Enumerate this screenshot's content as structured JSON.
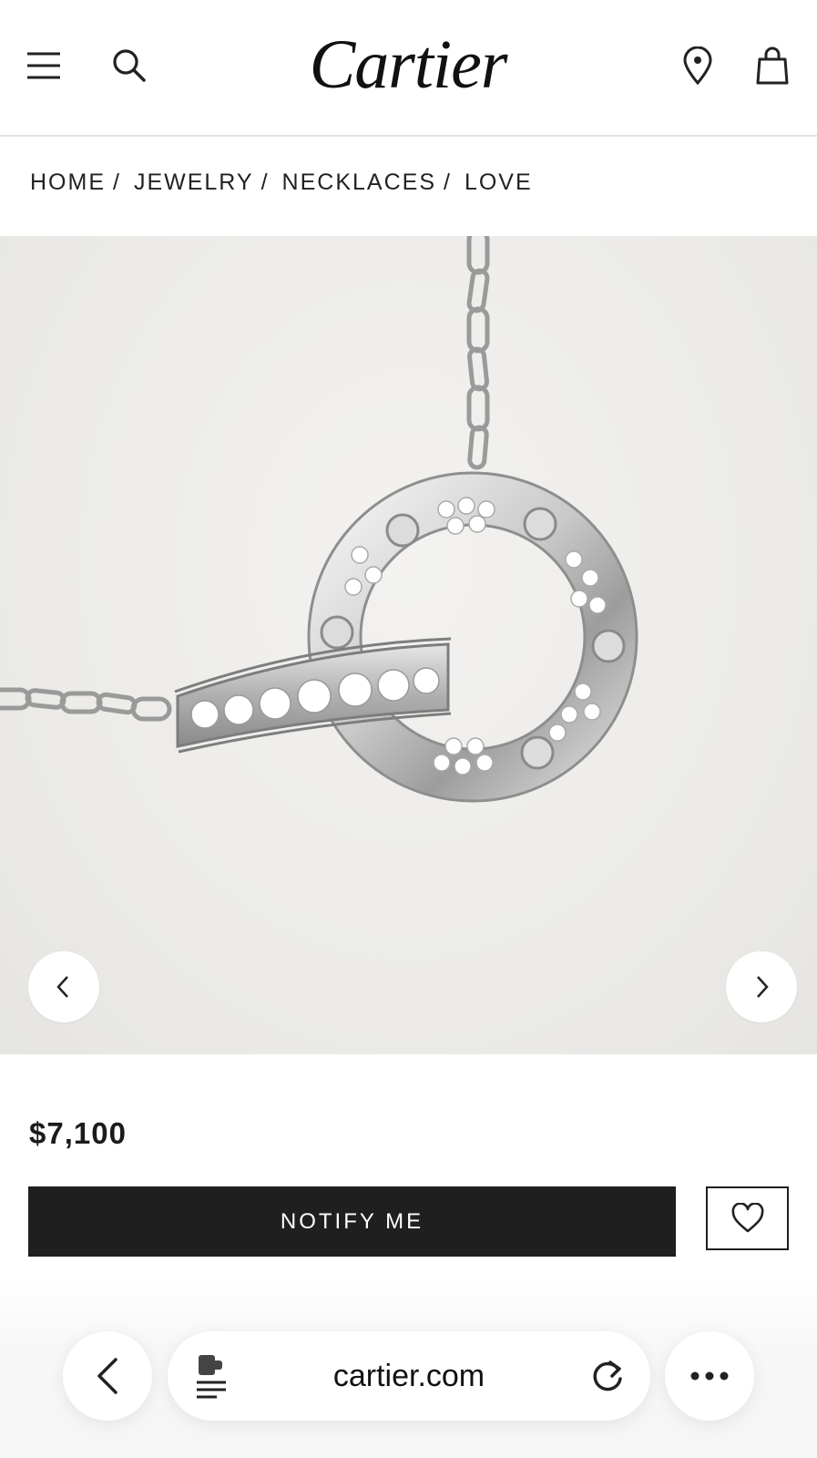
{
  "header": {
    "logo": "Cartier",
    "icons": [
      "menu-icon",
      "search-icon",
      "location-pin-icon",
      "shopping-bag-icon"
    ]
  },
  "breadcrumb": {
    "items": [
      "HOME",
      "JEWELRY",
      "NECKLACES",
      "LOVE"
    ],
    "separator": "/"
  },
  "gallery": {
    "prev_icon": "chevron-left-icon",
    "next_icon": "chevron-right-icon"
  },
  "product": {
    "price": "$7,100",
    "notify_label": "NOTIFY ME",
    "wishlist_icon": "heart-icon"
  },
  "browser": {
    "url": "cartier.com",
    "icons": [
      "back-arrow-icon",
      "reader-mode-icon",
      "reload-icon",
      "more-icon"
    ]
  },
  "colors": {
    "primary_button": "#1f1f1f",
    "text": "#1d1d1d",
    "image_background": "#eceae7"
  }
}
